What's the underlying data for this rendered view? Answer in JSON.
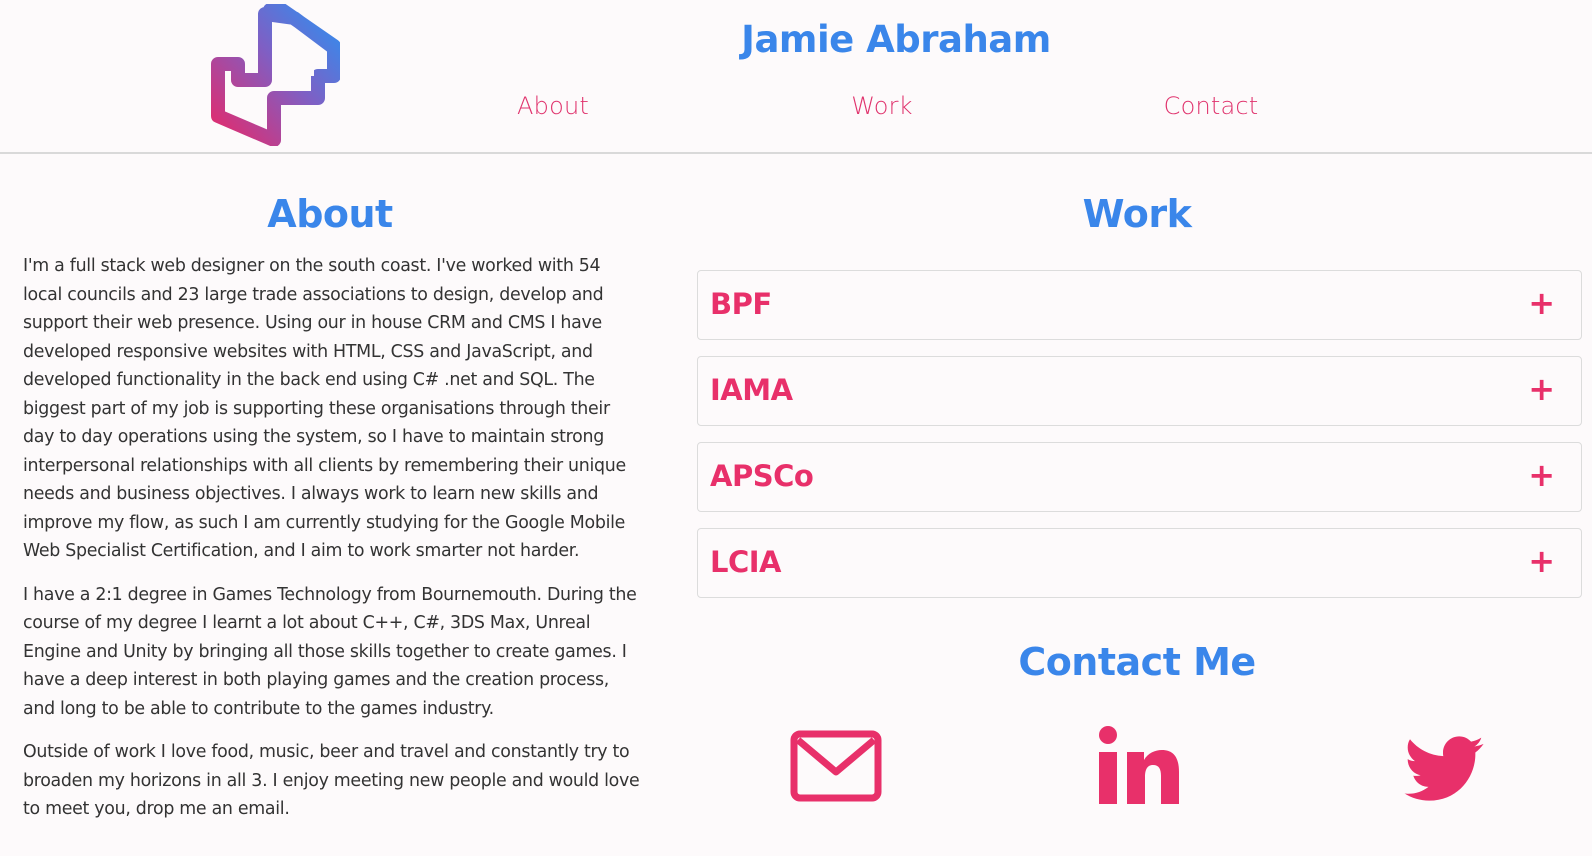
{
  "header": {
    "logo_icon": "ja-monogram-logo",
    "title": "Jamie Abraham",
    "nav": [
      {
        "label": "About"
      },
      {
        "label": "Work"
      },
      {
        "label": "Contact"
      }
    ]
  },
  "about": {
    "heading": "About",
    "paragraphs": [
      "I'm a full stack web designer on the south coast. I've worked with 54 local councils and 23 large trade associations to design, develop and support their web presence. Using our in house CRM and CMS I have developed responsive websites with HTML, CSS and JavaScript, and developed functionality in the back end using C# .net and SQL. The biggest part of my job is supporting these organisations through their day to day operations using the system, so I have to maintain strong interpersonal relationships with all clients by remembering their unique needs and business objectives. I always work to learn new skills and improve my flow, as such I am currently studying for the Google Mobile Web Specialist Certification, and I aim to work smarter not harder.",
      "I have a 2:1 degree in Games Technology from Bournemouth. During the course of my degree I learnt a lot about C++, C#, 3DS Max, Unreal Engine and Unity by bringing all those skills together to create games. I have a deep interest in both playing games and the creation process, and long to be able to contribute to the games industry.",
      "Outside of work I love food, music, beer and travel and constantly try to broaden my horizons in all 3. I enjoy meeting new people and would love to meet you, drop me an email."
    ]
  },
  "work": {
    "heading": "Work",
    "items": [
      {
        "title": "BPF",
        "toggle": "+"
      },
      {
        "title": "IAMA",
        "toggle": "+"
      },
      {
        "title": "APSCo",
        "toggle": "+"
      },
      {
        "title": "LCIA",
        "toggle": "+"
      }
    ]
  },
  "contact": {
    "heading": "Contact Me",
    "links": [
      {
        "icon": "mail-icon"
      },
      {
        "icon": "linkedin-icon"
      },
      {
        "icon": "twitter-icon"
      }
    ]
  },
  "colors": {
    "blue": "#3a86ea",
    "pink": "#e8306a",
    "background": "#fdfafb",
    "text": "#333333"
  }
}
